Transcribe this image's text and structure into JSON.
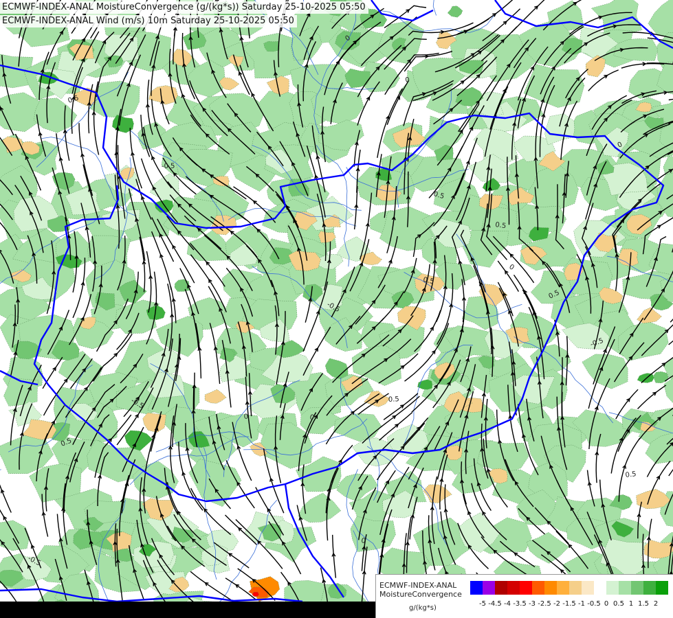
{
  "header": {
    "line1": "ECMWF-INDEX-ANAL MoistureConvergence (g/(kg*s)) Saturday 25-10-2025 05:50",
    "line2": "ECMWF-INDEX-ANAL Wind (m/s) 10m Saturday 25-10-2025 05:50"
  },
  "legend": {
    "title_line1": "ECMWF-INDEX-ANAL",
    "title_line2": "MoistureConvergence",
    "units": "g/(kg*s)",
    "colors": [
      "#0000ff",
      "#9a00e6",
      "#b00000",
      "#d40000",
      "#ff0000",
      "#ff5a00",
      "#ff8a00",
      "#ffb03c",
      "#f5cf8a",
      "#fbe8c6",
      "#ffffff",
      "#d4f2d2",
      "#a6e0a6",
      "#72c672",
      "#3eb03e",
      "#0aa00a"
    ],
    "ticks": [
      "-5",
      "-4.5",
      "-4",
      "-3.5",
      "-3",
      "-2.5",
      "-2",
      "-1.5",
      "-1",
      "-0.5",
      "0",
      "0.5",
      "1",
      "1.5",
      "2"
    ]
  },
  "contour_labels": [
    "0",
    "0.5",
    "-0.5",
    "0.5",
    "0",
    "-0.5",
    "0.5",
    "0",
    "-0.5",
    "0.5",
    "0",
    "0.5",
    "-0.5",
    "0",
    "0.5",
    "0",
    "-0.5",
    "0.5",
    "0",
    "0.5"
  ],
  "colors": {
    "border": "#0000ff",
    "river": "#3a6fd8",
    "streamline": "#000000",
    "bottom_strip": "#000000"
  }
}
